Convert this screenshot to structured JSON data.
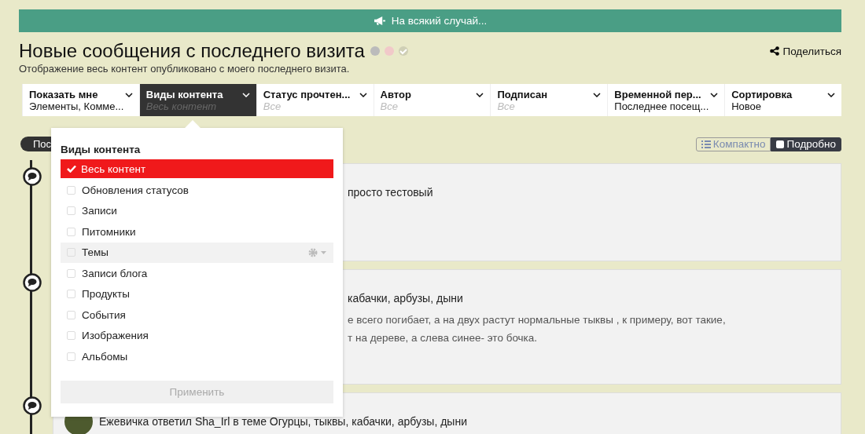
{
  "banner": {
    "text": "На всякий случай..."
  },
  "header": {
    "title": "Новые сообщения с последнего визита",
    "subtitle": "Отображение весь контент опубликовано с моего последнего визита.",
    "share": "Поделиться"
  },
  "filters": [
    {
      "label": "Показать мне",
      "value": "Элементы, Комме...",
      "default": false,
      "selected": false
    },
    {
      "label": "Виды контента",
      "value": "Весь контент",
      "default": true,
      "selected": true
    },
    {
      "label": "Статус прочтен...",
      "value": "Все",
      "default": true,
      "selected": false
    },
    {
      "label": "Автор",
      "value": "Все",
      "default": true,
      "selected": false
    },
    {
      "label": "Подписан",
      "value": "Все",
      "default": true,
      "selected": false
    },
    {
      "label": "Временной пер...",
      "value": "Последнее посещ...",
      "default": false,
      "selected": false
    },
    {
      "label": "Сортировка",
      "value": "Новое",
      "default": false,
      "selected": false
    }
  ],
  "dropdown": {
    "title": "Виды контента",
    "apply": "Применить",
    "items": [
      {
        "label": "Весь контент",
        "checked": true,
        "highlighted": false
      },
      {
        "label": "Обновления статусов",
        "checked": false,
        "highlighted": false
      },
      {
        "label": "Записи",
        "checked": false,
        "highlighted": false
      },
      {
        "label": "Питомники",
        "checked": false,
        "highlighted": false
      },
      {
        "label": "Темы",
        "checked": false,
        "highlighted": true
      },
      {
        "label": "Записи блога",
        "checked": false,
        "highlighted": false
      },
      {
        "label": "Продукты",
        "checked": false,
        "highlighted": false
      },
      {
        "label": "События",
        "checked": false,
        "highlighted": false
      },
      {
        "label": "Изображения",
        "checked": false,
        "highlighted": false
      },
      {
        "label": "Альбомы",
        "checked": false,
        "highlighted": false
      }
    ]
  },
  "timeline": {
    "label": "Пос"
  },
  "view_toggle": [
    {
      "label": "Компактно",
      "selected": false
    },
    {
      "label": "Подробно",
      "selected": true
    }
  ],
  "cards": [
    {
      "kind": "post",
      "lines": [
        {
          "kind": "title",
          "text": "просто тестовый"
        }
      ]
    },
    {
      "kind": "post",
      "lines": [
        {
          "kind": "title",
          "text": "кабачки, арбузы, дыни"
        },
        {
          "kind": "body",
          "text": "е всего погибает, а на двух растут нормальные тыквы , к примеру, вот такие,"
        },
        {
          "kind": "body",
          "text": "т на дереве, а слева синее- это бочка."
        }
      ]
    },
    {
      "kind": "reply",
      "lines": [
        {
          "kind": "title",
          "text": "Ежевичка ответил Sha_Irl в теме Огурцы, тыквы, кабачки, арбузы, дыни"
        }
      ]
    }
  ]
}
